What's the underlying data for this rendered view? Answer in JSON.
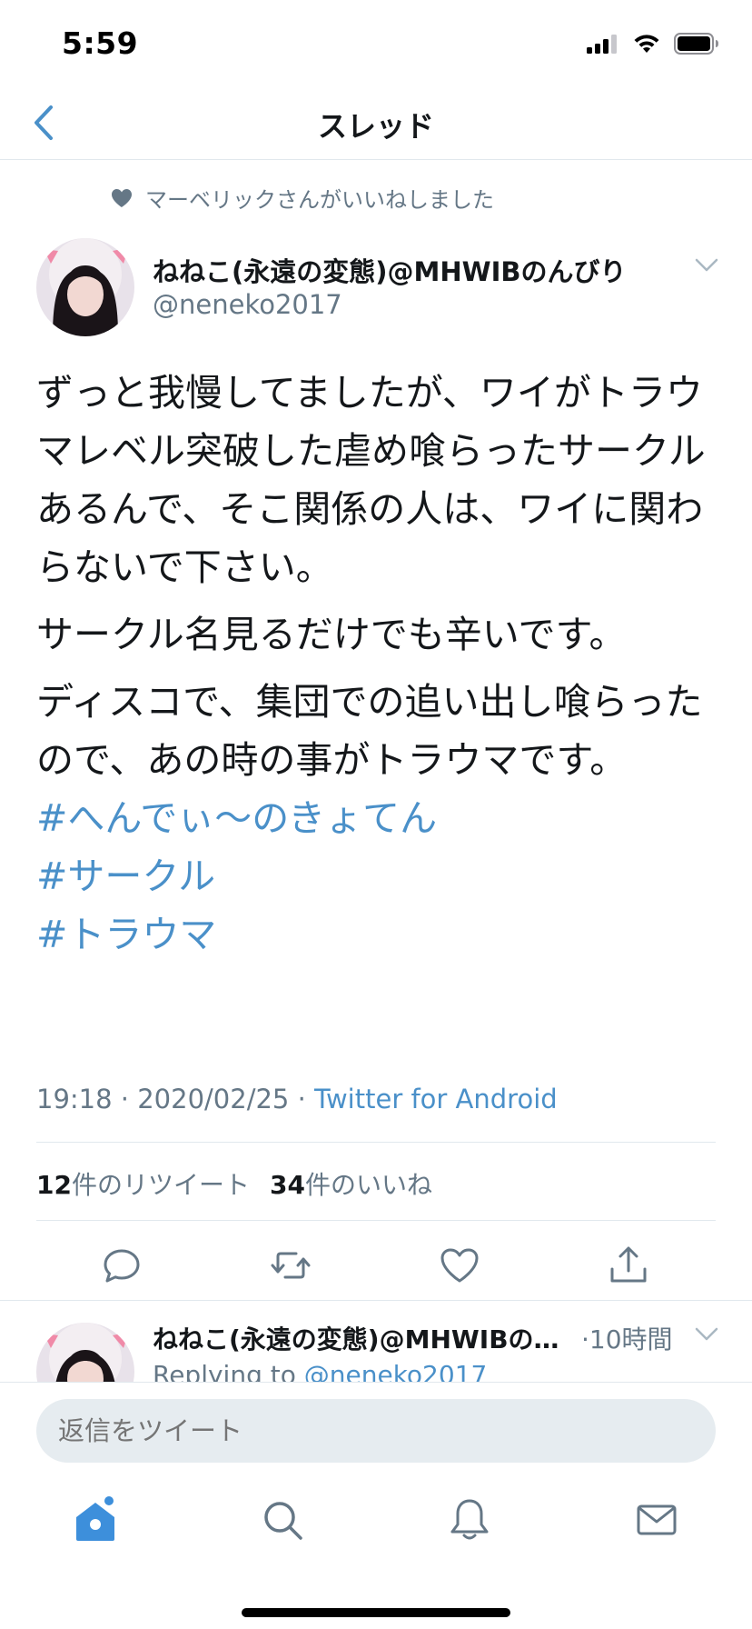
{
  "status_bar": {
    "time": "5:59"
  },
  "nav": {
    "title": "スレッド"
  },
  "social_context": {
    "text": "マーベリックさんがいいねしました",
    "icon": "heart-icon"
  },
  "tweet": {
    "author_name": "ねねこ(永遠の変態)@MHWIBのんびり",
    "author_handle": "@neneko2017",
    "paragraphs": [
      "ずっと我慢してましたが、ワイがトラウマレベル突破した虐め喰らったサークルあるんで、そこ関係の人は、ワイに関わらないで下さい。",
      "サークル名見るだけでも辛いです。",
      "ディスコで、集団での追い出し喰らったので、あの時の事がトラウマです。"
    ],
    "hashtags": [
      "#へんでぃ〜のきょてん",
      "#サークル",
      "#トラウマ"
    ],
    "time": "19:18",
    "date": "2020/02/25",
    "separator": " · ",
    "source": "Twitter for Android",
    "retweet_count": "12",
    "retweet_label": "件のリツイート",
    "like_count": "34",
    "like_label": "件のいいね"
  },
  "reply": {
    "author_name": "ねねこ(永遠の変態)@MHWIBの…",
    "time": "·10時間",
    "replying_prefix": "Replying to ",
    "replying_to": "@neneko2017"
  },
  "composer": {
    "placeholder": "返信をツイート"
  },
  "colors": {
    "accent": "#4a90c9",
    "secondary_text": "#657786",
    "primary_text": "#14171a",
    "divider": "#e1e8ed",
    "composer_bg": "#e6ecf0",
    "tab_active": "#3d8fdb"
  },
  "icons": {
    "back": "chevron-left-icon",
    "caret": "chevron-down-icon",
    "reply": "reply-icon",
    "retweet": "retweet-icon",
    "like": "heart-outline-icon",
    "share": "share-icon",
    "home": "home-icon",
    "search": "search-icon",
    "notifications": "bell-icon",
    "messages": "mail-icon"
  }
}
